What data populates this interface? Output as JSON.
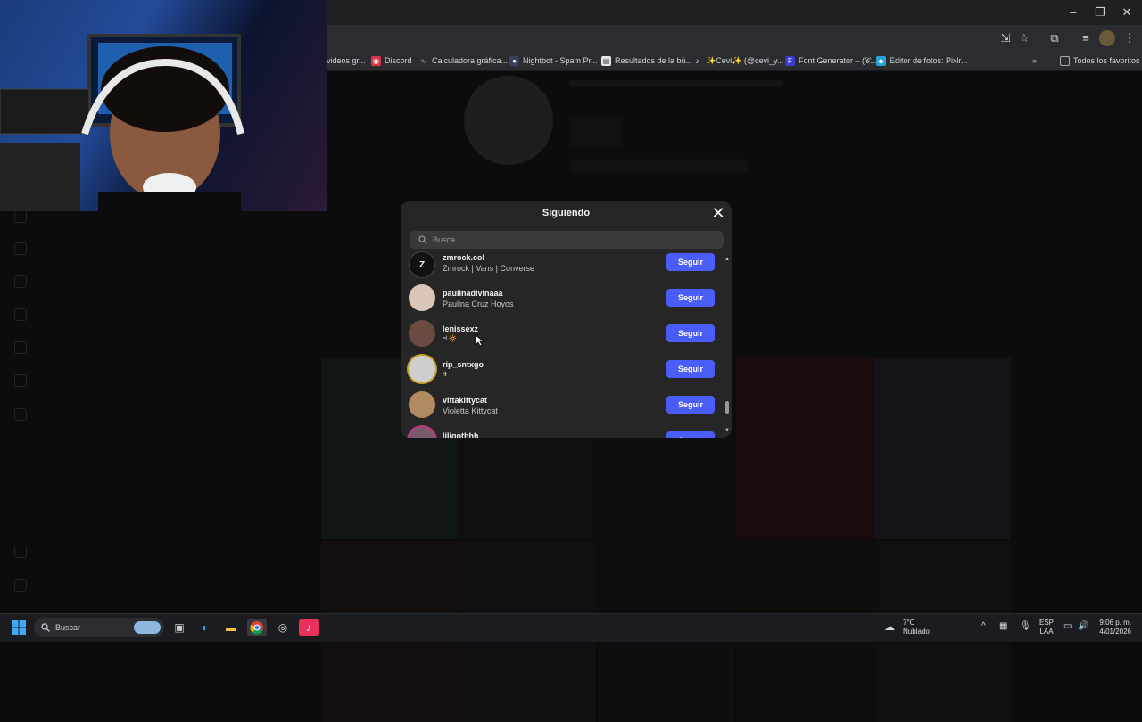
{
  "bookmarks": [
    "videos gr...",
    "Discord",
    "Calculadora gráfica...",
    "Nightbot - Spam Pr...",
    "Resultados de la bú...",
    "✨Cevi✨ (@cevi_y...",
    "Font Generator – (𝒞...",
    "Editor de fotos: Pixlr...",
    "Todos los favoritos"
  ],
  "modal": {
    "title": "Siguiendo",
    "search_placeholder": "Busca",
    "follow_label": "Seguir",
    "users": [
      {
        "username": "zmrock.col",
        "fullname": "Zmrock | Vans | Converse",
        "avatar": "#111111"
      },
      {
        "username": "paulinadivinaaa",
        "fullname": "Paulina Cruz Hoyos",
        "avatar": "#d9c6b8"
      },
      {
        "username": "lenissexz",
        "fullname": "el 🔆",
        "avatar": "#6b4a42"
      },
      {
        "username": "rip_sntxgo",
        "fullname": "✞",
        "avatar": "#cfcfcf"
      },
      {
        "username": "vittakittycat",
        "fullname": "Violetta Kittycat",
        "avatar": "#b28a62"
      },
      {
        "username": "liliqothhh",
        "fullname": "",
        "avatar": "#7a5a6a"
      }
    ]
  },
  "taskbar": {
    "search_label": "Buscar",
    "weather_temp": "7°C",
    "weather_desc": "Nublado",
    "lang_top": "ESP",
    "lang_bottom": "LAA",
    "time": "9:06 p. m.",
    "date": "4/01/2026"
  },
  "colors": {
    "accent": "#4a5df9",
    "modal_bg": "#262626"
  }
}
